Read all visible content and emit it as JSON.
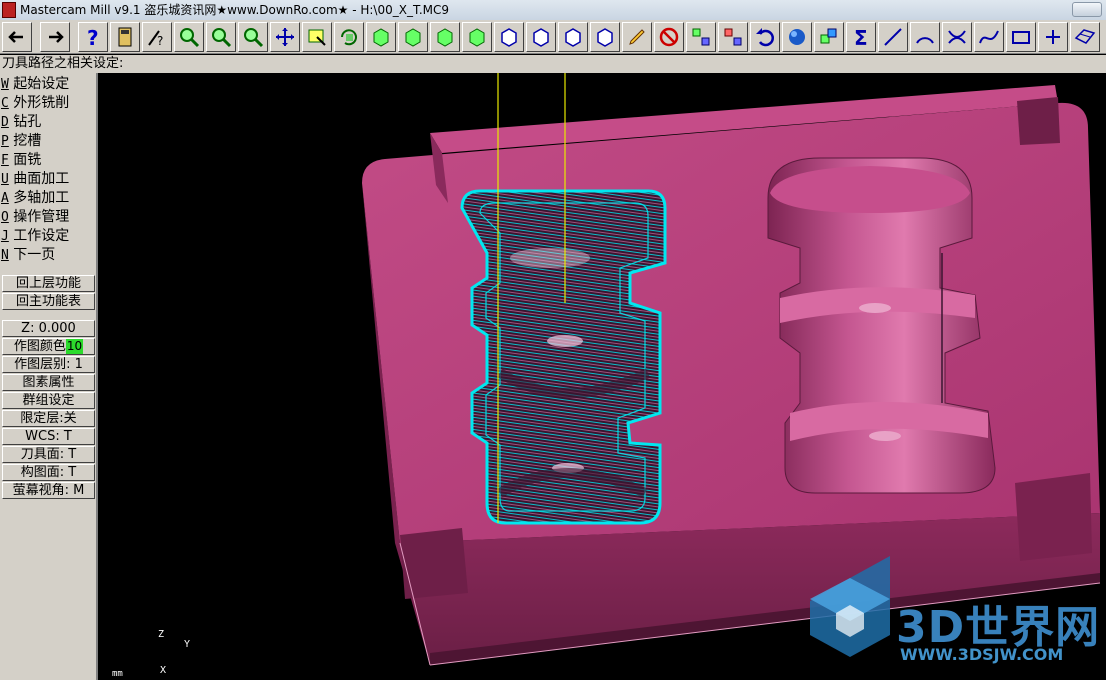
{
  "window": {
    "title": "Mastercam Mill v9.1 盗乐城资讯网★www.DownRo.com★ - H:\\00_X_T.MC9"
  },
  "toolbar": {
    "buttons": [
      {
        "name": "back-arrow-icon"
      },
      {
        "name": "forward-arrow-icon"
      },
      {
        "name": "help-icon"
      },
      {
        "name": "calculator-icon"
      },
      {
        "name": "analyze-icon"
      },
      {
        "name": "zoom-fit-icon"
      },
      {
        "name": "zoom-window-icon"
      },
      {
        "name": "zoom-out-icon"
      },
      {
        "name": "pan-icon"
      },
      {
        "name": "select-icon"
      },
      {
        "name": "rotate-view-icon"
      },
      {
        "name": "view-top-icon"
      },
      {
        "name": "view-front-icon"
      },
      {
        "name": "view-side-icon"
      },
      {
        "name": "view-iso-icon"
      },
      {
        "name": "cube-view-1-icon"
      },
      {
        "name": "cube-view-2-icon"
      },
      {
        "name": "cube-view-3-icon"
      },
      {
        "name": "cube-view-4-icon"
      },
      {
        "name": "pencil-icon"
      },
      {
        "name": "delete-icon"
      },
      {
        "name": "transform-icon"
      },
      {
        "name": "xform-icon"
      },
      {
        "name": "undo-icon"
      },
      {
        "name": "shade-sphere-icon"
      },
      {
        "name": "solids-icon"
      },
      {
        "name": "sum-icon"
      },
      {
        "name": "line-icon"
      },
      {
        "name": "arc-icon"
      },
      {
        "name": "fillet-icon"
      },
      {
        "name": "spline-icon"
      },
      {
        "name": "rectangle-icon"
      },
      {
        "name": "point-icon"
      },
      {
        "name": "surface-icon"
      }
    ]
  },
  "prompt": "刀具路径之相关设定:",
  "menu": {
    "items": [
      {
        "key": "W",
        "label": "起始设定"
      },
      {
        "key": "C",
        "label": "外形铣削"
      },
      {
        "key": "D",
        "label": "钻孔"
      },
      {
        "key": "P",
        "label": "挖槽"
      },
      {
        "key": "F",
        "label": "面铣"
      },
      {
        "key": "U",
        "label": "曲面加工"
      },
      {
        "key": "A",
        "label": "多轴加工"
      },
      {
        "key": "O",
        "label": "操作管理"
      },
      {
        "key": "J",
        "label": "工作设定"
      },
      {
        "key": "N",
        "label": "下一页"
      }
    ],
    "back_upper": "回上层功能",
    "back_main": "回主功能表"
  },
  "status": {
    "z": "Z:  0.000",
    "color_label": "作图颜色",
    "color_value": "10",
    "level": "作图层别: 1",
    "attributes": "图素属性",
    "group": "群组设定",
    "mask": "限定层:关",
    "wcs": "WCS:  T",
    "tool_plane": "刀具面: T",
    "construct_plane": "构图面: T",
    "screen_view": "萤幕视角: M"
  },
  "viewport": {
    "axis_z": "Z",
    "axis_y": "Y",
    "axis_x": "X",
    "units": "mm",
    "watermark_text": "3D世界网",
    "watermark_url": "WWW.3DSJW.COM"
  },
  "colors": {
    "part": "#b03a72",
    "toolpath": "#00e8f0",
    "tool_line": "#e8e800",
    "background": "#000000",
    "active_color_swatch": "#2cdb2c"
  }
}
